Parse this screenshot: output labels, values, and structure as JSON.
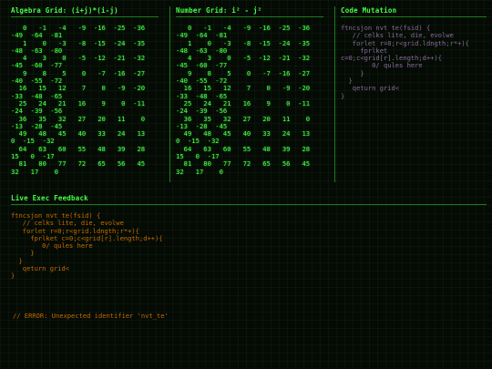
{
  "panels": {
    "algebra": {
      "title": "Algebra Grid: (i+j)*(i-j)",
      "lines": [
        "   0   -1   -4   -9  -16  -25  -36",
        "-49  -64  -81",
        "   1    0   -3   -8  -15  -24  -35",
        "-48  -63  -80",
        "   4    3    0   -5  -12  -21  -32",
        "-45  -60  -77",
        "   9    8    5    0   -7  -16  -27",
        "-40  -55  -72",
        "  16   15   12    7    0   -9  -20",
        "-33  -48  -65",
        "  25   24   21   16    9    0  -11",
        "-24  -39  -56",
        "  36   35   32   27   20   11    0",
        "-13  -28  -45",
        "  49   48   45   40   33   24   13",
        "0  -15  -32",
        "  64   63   60   55   48   39   28",
        "15   0  -17",
        "  81   80   77   72   65   56   45",
        "32   17    0"
      ]
    },
    "number": {
      "title": "Number Grid: i² - j²",
      "lines": [
        "   0   -1   -4   -9  -16  -25  -36",
        "-49  -64  -81",
        "   1    0   -3   -8  -15  -24  -35",
        "-48  -63  -80",
        "   4    3    0   -5  -12  -21  -32",
        "-45  -60  -77",
        "   9    8    5    0   -7  -16  -27",
        "-40  -55  -72",
        "  16   15   12    7    0   -9  -20",
        "-33  -48  -65",
        "  25   24   21   16    9    0  -11",
        "-24  -39  -56",
        "  36   35   32   27   20   11    0",
        "-13  -28  -45",
        "  49   48   45   40   33   24   13",
        "0  -15  -32",
        "  64   63   60   55   48   39   28",
        "15   0  -17",
        "  81   80   77   72   65   56   45",
        "32   17    0"
      ]
    },
    "mutation": {
      "title": "Code Mutation",
      "lines": [
        "ftncsjon nvt te(fsid) {",
        "   // celks lite, die, evolwe",
        "   forlet r=0;r<grid.ldngth;r*+){",
        "     fprlket",
        "c=0;c<grid[r].length;d++){",
        "        0/ qules here",
        "     }",
        "  }",
        "   qeturn grid<",
        "}"
      ]
    },
    "feedback": {
      "title": "Live Exec Feedback",
      "lines": [
        "ftncsjon nvt te(fsid) {",
        "   // celks lite, die, evolwe",
        "   forlet r=0;r<grid.ldngth;r*+){",
        "     fprlket c=0;c<grid[r].length;d++){",
        "        0/ qules here",
        "     }",
        "  }",
        "   qeturn grid<",
        "}"
      ],
      "error": "// ERROR: Unexpected identifier 'nvt_te'"
    }
  },
  "colors": {
    "background": "#050a05",
    "grid_text": "#4dff4d",
    "code_text": "#8a6a9a",
    "feedback_text": "#c46a00",
    "separator": "#1e7a1e"
  }
}
